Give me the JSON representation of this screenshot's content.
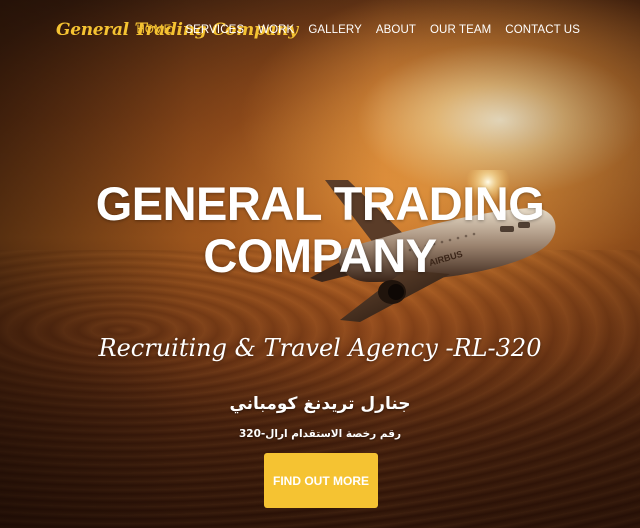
{
  "brand": {
    "name": "General Trading Company",
    "color": "#f5c332"
  },
  "nav": {
    "items": [
      {
        "label": "HOME",
        "active": true
      },
      {
        "label": "SERVICES",
        "active": false
      },
      {
        "label": "WORK",
        "active": false
      },
      {
        "label": "GALLERY",
        "active": false
      },
      {
        "label": "ABOUT",
        "active": false
      },
      {
        "label": "OUR TEAM",
        "active": false
      },
      {
        "label": "CONTACT US",
        "active": false
      }
    ],
    "active_color": "#f5c332"
  },
  "hero": {
    "headline_line1": "GENERAL TRADING",
    "headline_line2": "COMPANY",
    "subtitle": "Recruiting & Travel Agency -RL-320",
    "arabic_title": "جنارل تريدنغ كومباني",
    "arabic_license": "رقم رخصة الاستقدام ارال-320",
    "cta_label": "FIND OUT MORE",
    "cta_color": "#f5c332",
    "plane_livery": "AIRBUS",
    "background": "airplane-above-clouds-sunset"
  }
}
